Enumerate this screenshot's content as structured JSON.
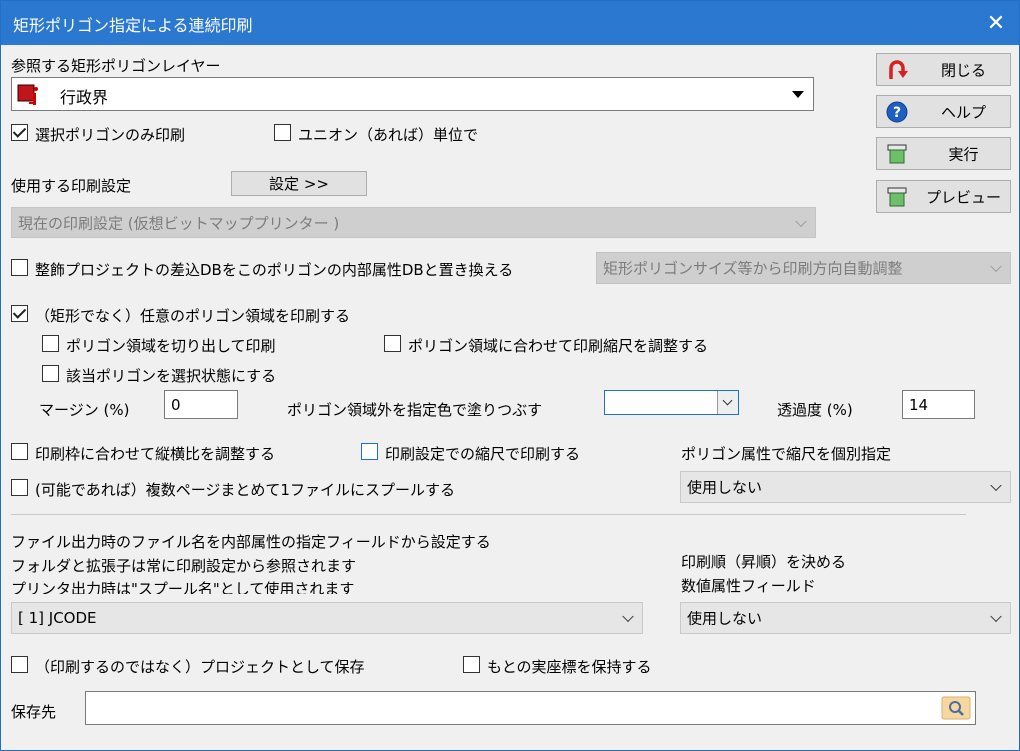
{
  "window": {
    "title": "矩形ポリゴン指定による連続印刷",
    "close_glyph": "✕"
  },
  "layer": {
    "label": "参照する矩形ポリゴンレイヤー",
    "value": "行政界"
  },
  "checks": {
    "selected_only": "選択ポリゴンのみ印刷",
    "union": "ユニオン（あれば）単位で",
    "replace_db": "整飾プロジェクトの差込DBをこのポリゴンの内部属性DBと置き換える",
    "arbitrary": "（矩形でなく）任意のポリゴン領域を印刷する",
    "cut_out": "ポリゴン領域を切り出して印刷",
    "fit_scale": "ポリゴン領域に合わせて印刷縮尺を調整する",
    "select_state": "該当ポリゴンを選択状態にする",
    "aspect": "印刷枠に合わせて縦横比を調整する",
    "print_scale": "印刷設定での縮尺で印刷する",
    "spool": "(可能であれば）複数ページまとめて1ファイルにスプールする",
    "save_project": "（印刷するのではなく）プロジェクトとして保存",
    "keep_coords": "もとの実座標を保持する"
  },
  "print_settings": {
    "label": "使用する印刷設定",
    "button": "設定 >>",
    "current": "現在の印刷設定 (仮想ビットマッププリンター )"
  },
  "orientation_combo": "矩形ポリゴンサイズ等から印刷方向自動調整",
  "margin": {
    "label": "マージン (%)",
    "value": "0"
  },
  "fill": {
    "label": "ポリゴン領域外を指定色で塗りつぶす"
  },
  "transparency": {
    "label": "透過度 (%)",
    "value": "14"
  },
  "polygon_scale": {
    "label": "ポリゴン属性で縮尺を個別指定",
    "value": "使用しない"
  },
  "filename": {
    "line1": "ファイル出力時のファイル名を内部属性の指定フィールドから設定する",
    "line2": "フォルダと拡張子は常に印刷設定から参照されます",
    "line3": "プリンタ出力時は\"スプール名\"として使用されます",
    "value": "[ 1] JCODE"
  },
  "order": {
    "line1": "印刷順（昇順）を決める",
    "line2": "数値属性フィールド",
    "value": "使用しない"
  },
  "save_to": {
    "label": "保存先",
    "value": ""
  },
  "buttons": {
    "close": "閉じる",
    "help": "ヘルプ",
    "run": "実行",
    "preview": "プレビュー"
  },
  "colors": {
    "titlebar": "#2b78d0",
    "accent": "#1e6fd0",
    "close_icon": "#d81e1e"
  }
}
